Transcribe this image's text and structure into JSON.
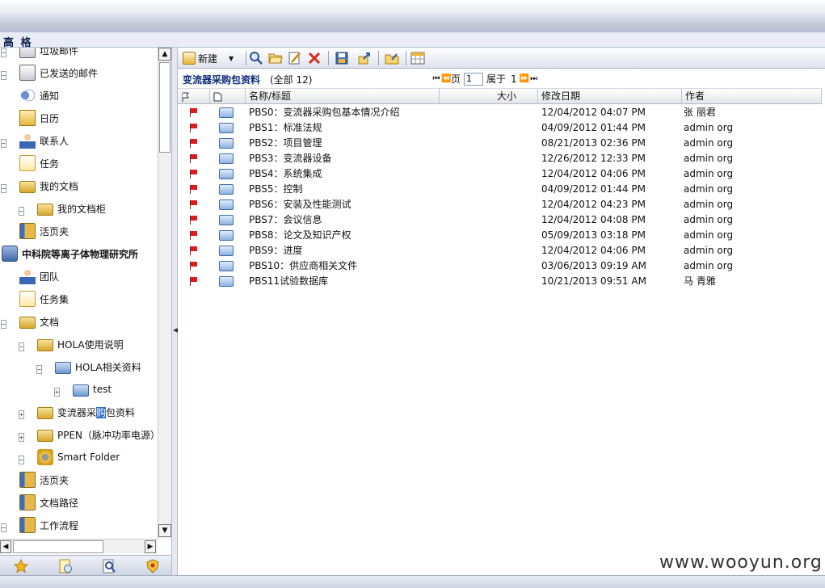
{
  "user": {
    "name": "高 格"
  },
  "tree": {
    "items": [
      {
        "label": "垃圾邮件",
        "toggle": "−",
        "icon": "trash-mail-icon",
        "indent": 0
      },
      {
        "label": "已发送的邮件",
        "toggle": "−",
        "icon": "sent-mail-icon",
        "indent": 0
      },
      {
        "label": "通知",
        "toggle": "",
        "icon": "sound-icon",
        "indent": 0
      },
      {
        "label": "日历",
        "toggle": "",
        "icon": "calendar-icon",
        "indent": 0
      },
      {
        "label": "联系人",
        "toggle": "−",
        "icon": "contacts-icon",
        "indent": 0
      },
      {
        "label": "任务",
        "toggle": "",
        "icon": "task-icon",
        "indent": 0
      },
      {
        "label": "我的文档",
        "toggle": "−",
        "icon": "folder-icon",
        "indent": 0
      },
      {
        "label": "我的文档柜",
        "toggle": "−",
        "icon": "cabinet-icon",
        "indent": 1
      },
      {
        "label": "活页夹",
        "toggle": "",
        "icon": "binder-icon",
        "indent": 0
      },
      {
        "label": "中科院等离子体物理研究所",
        "toggle": "−",
        "icon": "organization-icon",
        "indent": -1,
        "bold": true
      },
      {
        "label": "团队",
        "toggle": "",
        "icon": "team-icon",
        "indent": 0
      },
      {
        "label": "任务集",
        "toggle": "",
        "icon": "taskset-icon",
        "indent": 0
      },
      {
        "label": "文档",
        "toggle": "−",
        "icon": "documents-folder-icon",
        "indent": 0
      },
      {
        "label": "HOLA使用说明",
        "toggle": "−",
        "icon": "cabinet-icon",
        "indent": 1
      },
      {
        "label": "HOLA相关资料",
        "toggle": "−",
        "icon": "blue-folder-icon",
        "indent": 2
      },
      {
        "label": "test",
        "toggle": "+",
        "icon": "blue-folder-icon",
        "indent": 3
      },
      {
        "label_pre": "变流器采",
        "label_hl": "购",
        "label_post": "包资料",
        "toggle": "+",
        "icon": "cabinet-icon",
        "indent": 1,
        "selected": true
      },
      {
        "label": "PPEN（脉冲功率电源）",
        "toggle": "+",
        "icon": "cabinet-icon",
        "indent": 1
      },
      {
        "label": "Smart Folder",
        "toggle": "−",
        "icon": "smart-folder-icon",
        "indent": 1
      },
      {
        "label": "活页夹",
        "toggle": "",
        "icon": "binder-icon",
        "indent": 0
      },
      {
        "label": "文档路径",
        "toggle": "",
        "icon": "doc-path-icon",
        "indent": 0
      },
      {
        "label": "工作流程",
        "toggle": "−",
        "icon": "workflow-icon",
        "indent": 0
      }
    ]
  },
  "toolbar": {
    "new_label": "新建"
  },
  "folder": {
    "title": "变流器采购包资料",
    "count_text": "(全部  12)"
  },
  "pager": {
    "page_label": "页",
    "page_value": "1",
    "of_label": "属于",
    "total_pages": "1"
  },
  "grid": {
    "headers": {
      "name": "名称/标题",
      "size": "大小",
      "modified": "修改日期",
      "author": "作者"
    },
    "rows": [
      {
        "name": "PBS0：变流器采购包基本情况介绍",
        "modified": "12/04/2012 04:07 PM",
        "author": "张 丽君"
      },
      {
        "name": "PBS1：标准法规",
        "modified": "04/09/2012 01:44 PM",
        "author": "admin org"
      },
      {
        "name": "PBS2：项目管理",
        "modified": "08/21/2013 02:36 PM",
        "author": "admin org"
      },
      {
        "name": "PBS3：变流器设备",
        "modified": "12/26/2012 12:33 PM",
        "author": "admin org"
      },
      {
        "name": "PBS4：系统集成",
        "modified": "12/04/2012 04:06 PM",
        "author": "admin org"
      },
      {
        "name": "PBS5：控制",
        "modified": "04/09/2012 01:44 PM",
        "author": "admin org"
      },
      {
        "name": "PBS6：安装及性能测试",
        "modified": "12/04/2012 04:23 PM",
        "author": "admin org"
      },
      {
        "name": "PBS7：会议信息",
        "modified": "12/04/2012 04:08 PM",
        "author": "admin org"
      },
      {
        "name": "PBS8：论文及知识产权",
        "modified": "05/09/2013 03:18 PM",
        "author": "admin org"
      },
      {
        "name": "PBS9：进度",
        "modified": "12/04/2012 04:06 PM",
        "author": "admin org"
      },
      {
        "name": "PBS10：供应商相关文件",
        "modified": "03/06/2013 09:19 AM",
        "author": "admin org"
      },
      {
        "name": "PBS11试验数据库",
        "modified": "10/21/2013 09:51 AM",
        "author": "马 青雅"
      }
    ]
  },
  "watermark": "www.wooyun.org"
}
